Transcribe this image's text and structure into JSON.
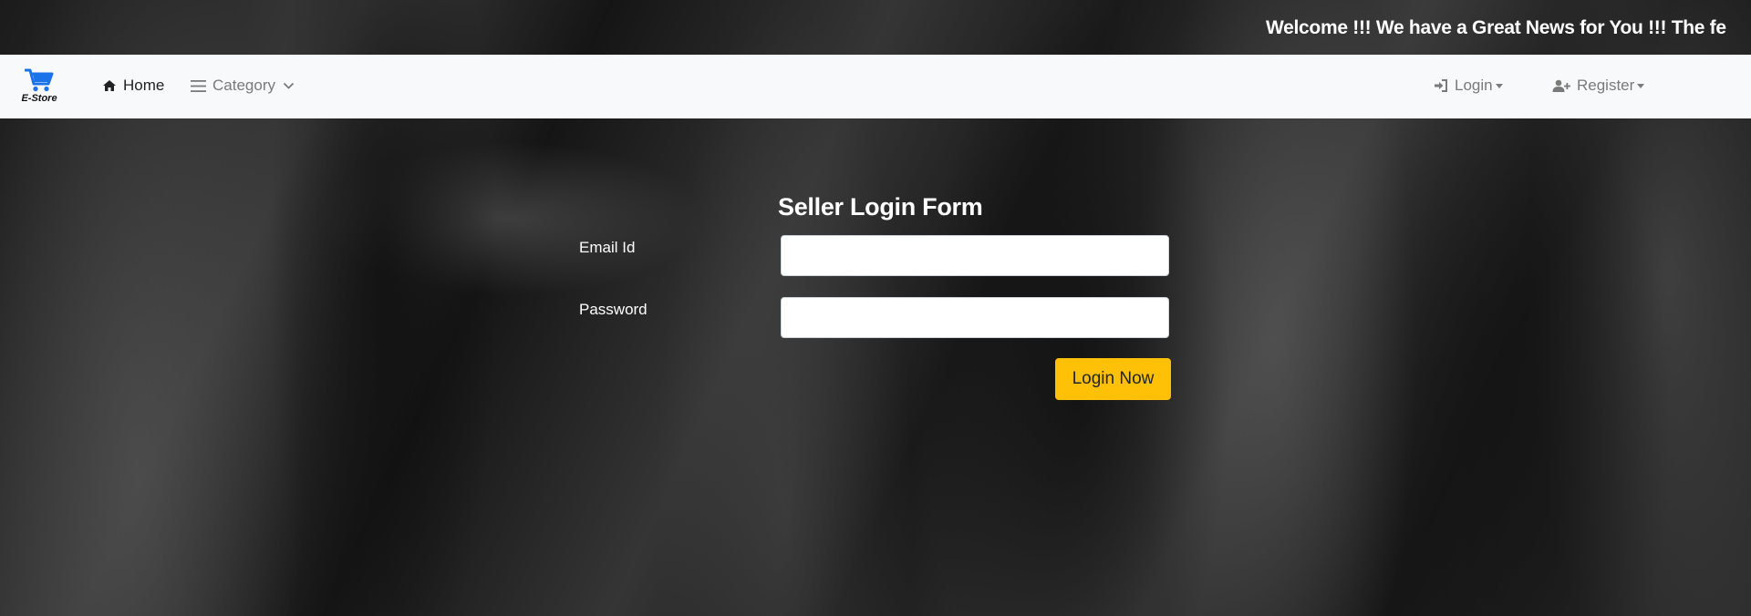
{
  "marquee": {
    "text": "Welcome !!! We have a Great News for You !!! The fe"
  },
  "navbar": {
    "brand_text": "E-Store",
    "home_label": "Home",
    "category_label": "Category",
    "login_label": "Login",
    "register_label": "Register"
  },
  "form": {
    "title": "Seller Login Form",
    "email_label": "Email Id",
    "email_value": "",
    "password_label": "Password",
    "password_value": "",
    "submit_label": "Login Now"
  },
  "colors": {
    "navbar_bg": "#f8f9fa",
    "button_accent": "#ffc107",
    "brand_icon": "#1a73e8"
  },
  "icons": {
    "brand": "cart-icon",
    "home": "home-icon",
    "category": "bars-icon",
    "category_dropdown": "chevron-down-icon",
    "login": "sign-in-icon",
    "register": "user-plus-icon"
  }
}
